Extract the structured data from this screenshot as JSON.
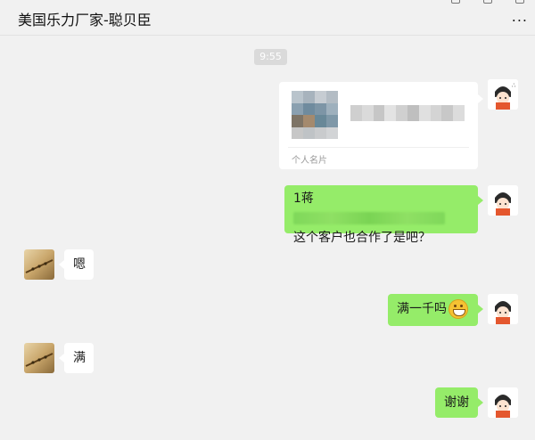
{
  "window": {
    "title": "美国乐力厂家-聪贝臣",
    "more_label": "..."
  },
  "timestamp": "9:55",
  "card": {
    "type_label": "个人名片"
  },
  "messages": [
    {
      "side": "right",
      "line1": "1蒋",
      "line2": "这个客户也合作了是吧？"
    },
    {
      "side": "left",
      "text": "嗯"
    },
    {
      "side": "right",
      "text": "满一千吗"
    },
    {
      "side": "left",
      "text": "满"
    },
    {
      "side": "right",
      "text": "谢谢"
    }
  ],
  "colors": {
    "bubble_green": "#95ec69",
    "bubble_white": "#ffffff",
    "background": "#f1f1f1"
  },
  "icons": {
    "emoji": "grinning-emoji-icon"
  }
}
